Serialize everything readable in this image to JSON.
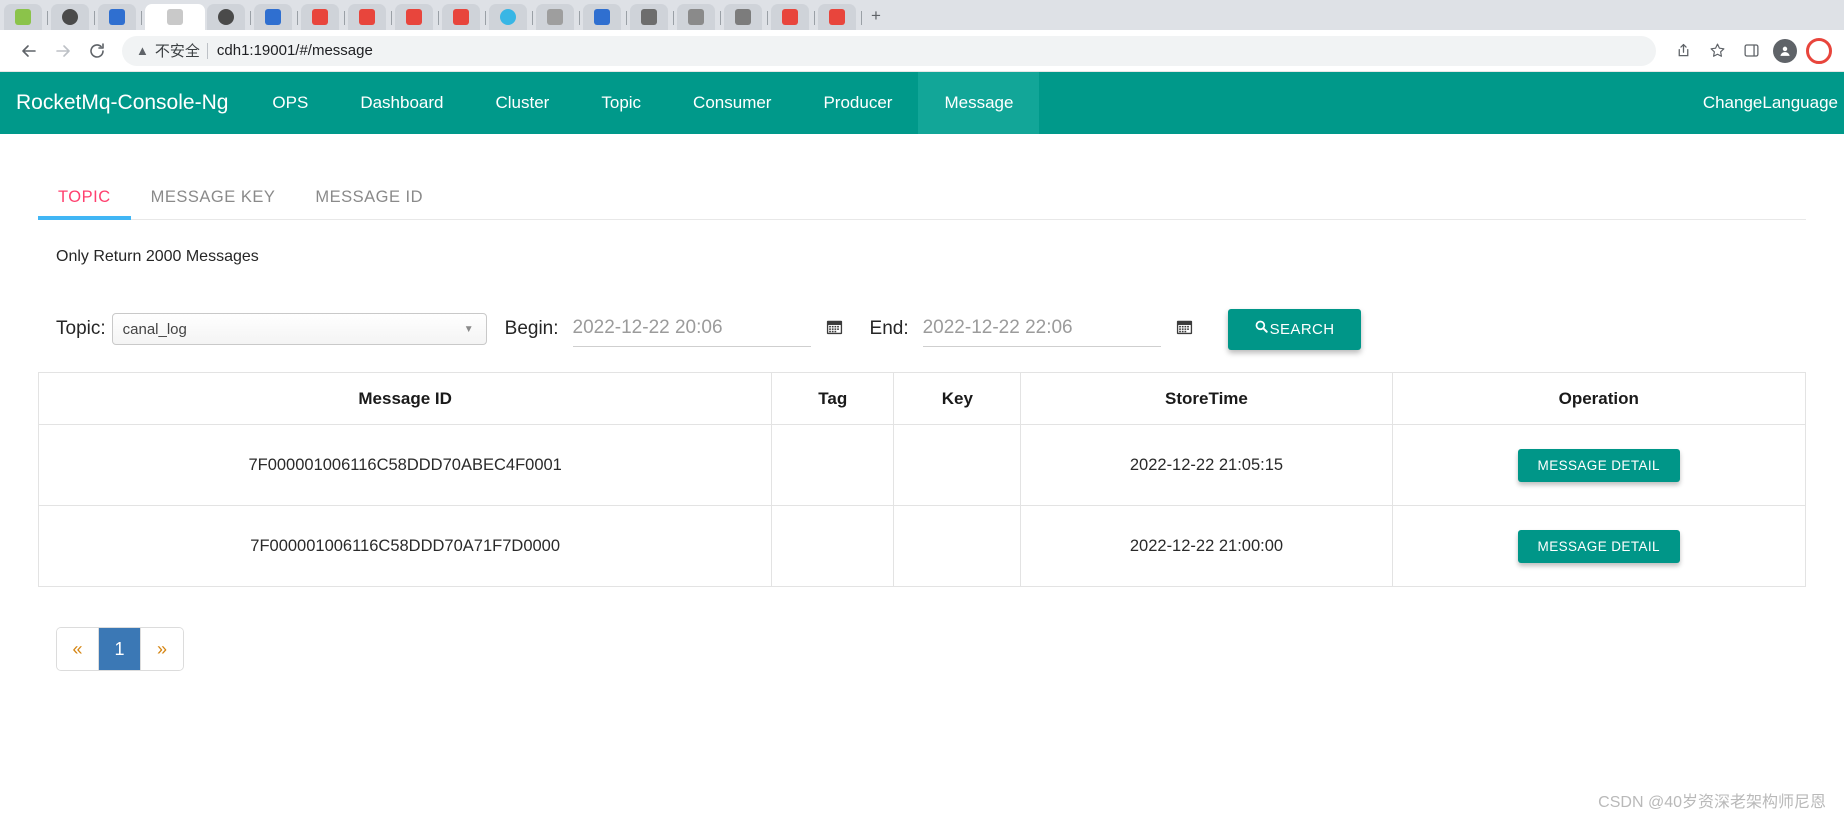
{
  "browser": {
    "back_icon": "arrow-left-icon",
    "forward_icon": "arrow-right-icon",
    "reload_icon": "reload-icon",
    "warning_icon": "warning-triangle-icon",
    "insecure_label": "不安全",
    "url": "cdh1:19001/#/message",
    "share_icon": "share-icon",
    "bookmark_icon": "star-icon",
    "sidepanel_icon": "sidepanel-icon",
    "profile_icon": "profile-avatar-icon",
    "new_tab_label": "+"
  },
  "navbar": {
    "brand": "RocketMq-Console-Ng",
    "items": [
      {
        "label": "OPS",
        "active": false
      },
      {
        "label": "Dashboard",
        "active": false
      },
      {
        "label": "Cluster",
        "active": false
      },
      {
        "label": "Topic",
        "active": false
      },
      {
        "label": "Consumer",
        "active": false
      },
      {
        "label": "Producer",
        "active": false
      },
      {
        "label": "Message",
        "active": true
      }
    ],
    "change_language": "ChangeLanguage",
    "bg_color": "#00998a",
    "active_color": "#12a698"
  },
  "tabs": [
    {
      "label": "TOPIC",
      "active": true
    },
    {
      "label": "MESSAGE KEY",
      "active": false
    },
    {
      "label": "MESSAGE ID",
      "active": false
    }
  ],
  "tab_active_color": "#ff3f6e",
  "tab_underline_color": "#41b6f5",
  "notice": "Only Return 2000 Messages",
  "search_form": {
    "topic_label": "Topic:",
    "topic_value": "canal_log",
    "topic_caret_icon": "chevron-down-icon",
    "begin_label": "Begin:",
    "begin_value": "2022-12-22 20:06",
    "begin_calendar_icon": "calendar-icon",
    "end_label": "End:",
    "end_value": "2022-12-22 22:06",
    "end_calendar_icon": "calendar-icon",
    "search_button": "SEARCH",
    "search_icon": "magnifier-icon",
    "accent_color": "#009688"
  },
  "table": {
    "columns": [
      "Message ID",
      "Tag",
      "Key",
      "StoreTime",
      "Operation"
    ],
    "rows": [
      {
        "message_id": "7F000001006116C58DDD70ABEC4F0001",
        "tag": "",
        "key": "",
        "store_time": "2022-12-22 21:05:15",
        "operation": "MESSAGE DETAIL"
      },
      {
        "message_id": "7F000001006116C58DDD70A71F7D0000",
        "tag": "",
        "key": "",
        "store_time": "2022-12-22 21:00:00",
        "operation": "MESSAGE DETAIL"
      }
    ]
  },
  "pagination": {
    "prev": "«",
    "next": "»",
    "pages": [
      "1"
    ],
    "current": "1",
    "active_color": "#3b78b5"
  },
  "watermark": "CSDN @40岁资深老架构师尼恩"
}
